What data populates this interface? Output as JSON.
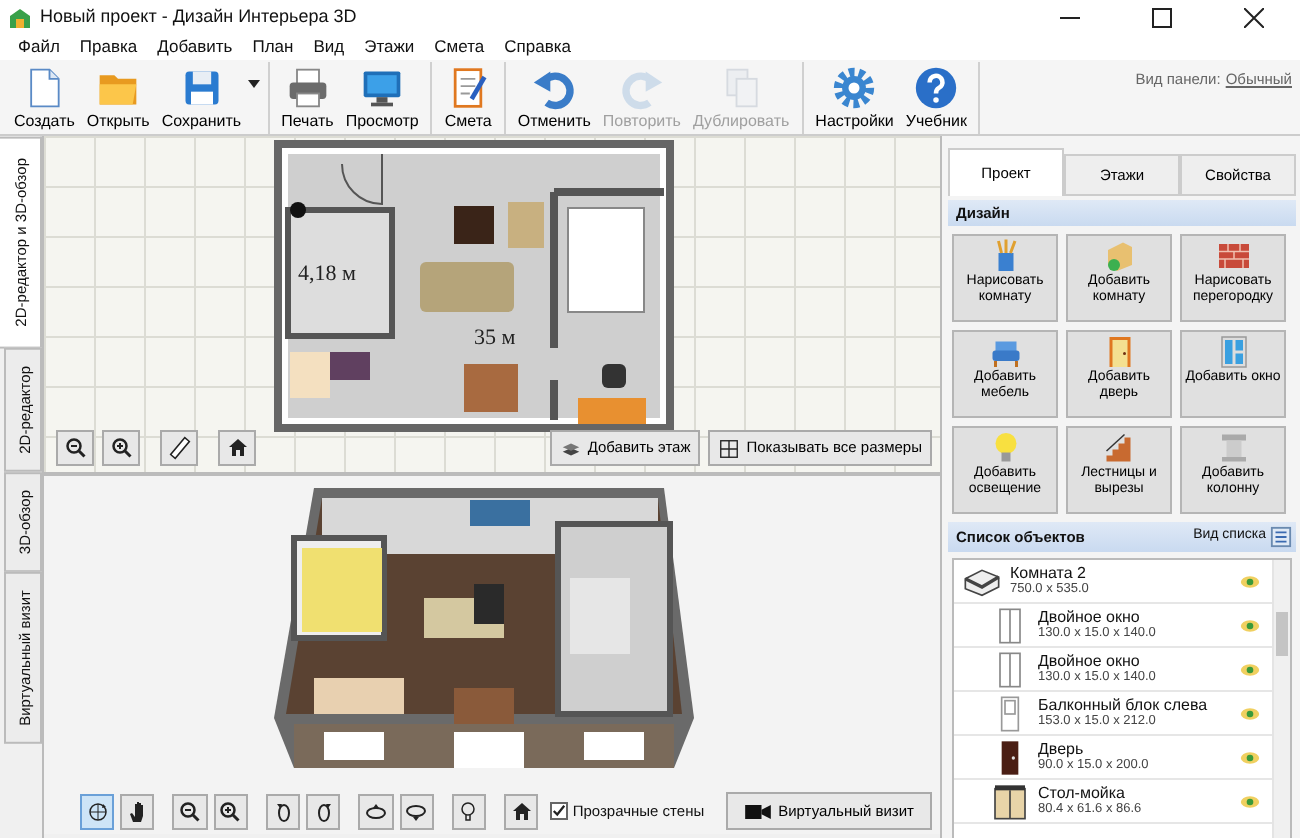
{
  "window": {
    "title": "Новый проект - Дизайн Интерьера 3D"
  },
  "menu": [
    "Файл",
    "Правка",
    "Добавить",
    "План",
    "Вид",
    "Этажи",
    "Смета",
    "Справка"
  ],
  "toolbar": {
    "groups": [
      [
        {
          "label": "Создать",
          "kind": "doc",
          "disabled": false,
          "dropdown": false
        },
        {
          "label": "Открыть",
          "kind": "folder",
          "disabled": false,
          "dropdown": false
        },
        {
          "label": "Сохранить",
          "kind": "floppy",
          "disabled": false,
          "dropdown": true
        }
      ],
      [
        {
          "label": "Печать",
          "kind": "printer",
          "disabled": false,
          "dropdown": false
        },
        {
          "label": "Просмотр",
          "kind": "monitor",
          "disabled": false,
          "dropdown": false
        }
      ],
      [
        {
          "label": "Смета",
          "kind": "notebook",
          "disabled": false,
          "dropdown": false
        }
      ],
      [
        {
          "label": "Отменить",
          "kind": "undo",
          "disabled": false,
          "dropdown": false
        },
        {
          "label": "Повторить",
          "kind": "redo",
          "disabled": true,
          "dropdown": false
        },
        {
          "label": "Дублировать",
          "kind": "copy",
          "disabled": true,
          "dropdown": false
        }
      ],
      [
        {
          "label": "Настройки",
          "kind": "gear",
          "disabled": false,
          "dropdown": false
        },
        {
          "label": "Учебник",
          "kind": "help",
          "disabled": false,
          "dropdown": false
        }
      ]
    ],
    "panel_view_label": "Вид панели:",
    "panel_view_value": "Обычный"
  },
  "view_tabs": [
    {
      "label": "2D-редактор и 3D-обзор",
      "selected": true
    },
    {
      "label": "2D-редактор",
      "selected": false
    },
    {
      "label": "3D-обзор",
      "selected": false
    },
    {
      "label": "Виртуальный визит",
      "selected": false
    }
  ],
  "plan": {
    "room_labels": [
      "4,18 м",
      "35 м"
    ],
    "tools": [
      {
        "kind": "zoom-out"
      },
      {
        "kind": "zoom-in"
      },
      {
        "kind": "ruler"
      },
      {
        "kind": "home"
      }
    ],
    "buttons": [
      {
        "label": "Добавить этаж",
        "kind": "floors"
      },
      {
        "label": "Показывать все размеры",
        "kind": "dims"
      }
    ]
  },
  "view3d": {
    "tools": [
      {
        "kind": "rotate",
        "selected": true
      },
      {
        "kind": "hand",
        "selected": false
      },
      {
        "kind": "zoom-out",
        "selected": false
      },
      {
        "kind": "zoom-in",
        "selected": false
      },
      {
        "kind": "turn-left",
        "selected": false
      },
      {
        "kind": "turn-right",
        "selected": false
      },
      {
        "kind": "tilt-up",
        "selected": false
      },
      {
        "kind": "tilt-down",
        "selected": false
      },
      {
        "kind": "bulb",
        "selected": false
      },
      {
        "kind": "home",
        "selected": false
      }
    ],
    "transparent_walls": {
      "label": "Прозрачные стены",
      "checked": true
    },
    "virtual_visit_button": "Виртуальный визит"
  },
  "side_tabs": [
    {
      "label": "Проект",
      "selected": true
    },
    {
      "label": "Этажи",
      "selected": false
    },
    {
      "label": "Свойства",
      "selected": false
    }
  ],
  "design": {
    "title": "Дизайн",
    "buttons": [
      {
        "label": "Нарисовать комнату",
        "kind": "draw-room"
      },
      {
        "label": "Добавить комнату",
        "kind": "add-room"
      },
      {
        "label": "Нарисовать перегородку",
        "kind": "wall"
      },
      {
        "label": "Добавить мебель",
        "kind": "furniture"
      },
      {
        "label": "Добавить дверь",
        "kind": "door"
      },
      {
        "label": "Добавить окно",
        "kind": "window"
      },
      {
        "label": "Добавить освещение",
        "kind": "light"
      },
      {
        "label": "Лестницы и вырезы",
        "kind": "stairs"
      },
      {
        "label": "Добавить колонну",
        "kind": "column"
      }
    ]
  },
  "objects": {
    "title": "Список объектов",
    "list_view_label": "Вид списка",
    "items": [
      {
        "name": "Комната 2",
        "size": "750.0 x 535.0",
        "kind": "room",
        "visible": true,
        "children": [
          {
            "name": "Двойное окно",
            "size": "130.0 x 15.0 x 140.0",
            "kind": "window-frame",
            "visible": true
          },
          {
            "name": "Двойное окно",
            "size": "130.0 x 15.0 x 140.0",
            "kind": "window-frame",
            "visible": true
          },
          {
            "name": "Балконный блок слева",
            "size": "153.0 x 15.0 x 212.0",
            "kind": "balcony",
            "visible": true
          },
          {
            "name": "Дверь",
            "size": "90.0 x 15.0 x 200.0",
            "kind": "door-leaf",
            "visible": true
          },
          {
            "name": "Стол-мойка",
            "size": "80.4 x 61.6 x 86.6",
            "kind": "cabinet",
            "visible": true
          }
        ]
      }
    ]
  }
}
